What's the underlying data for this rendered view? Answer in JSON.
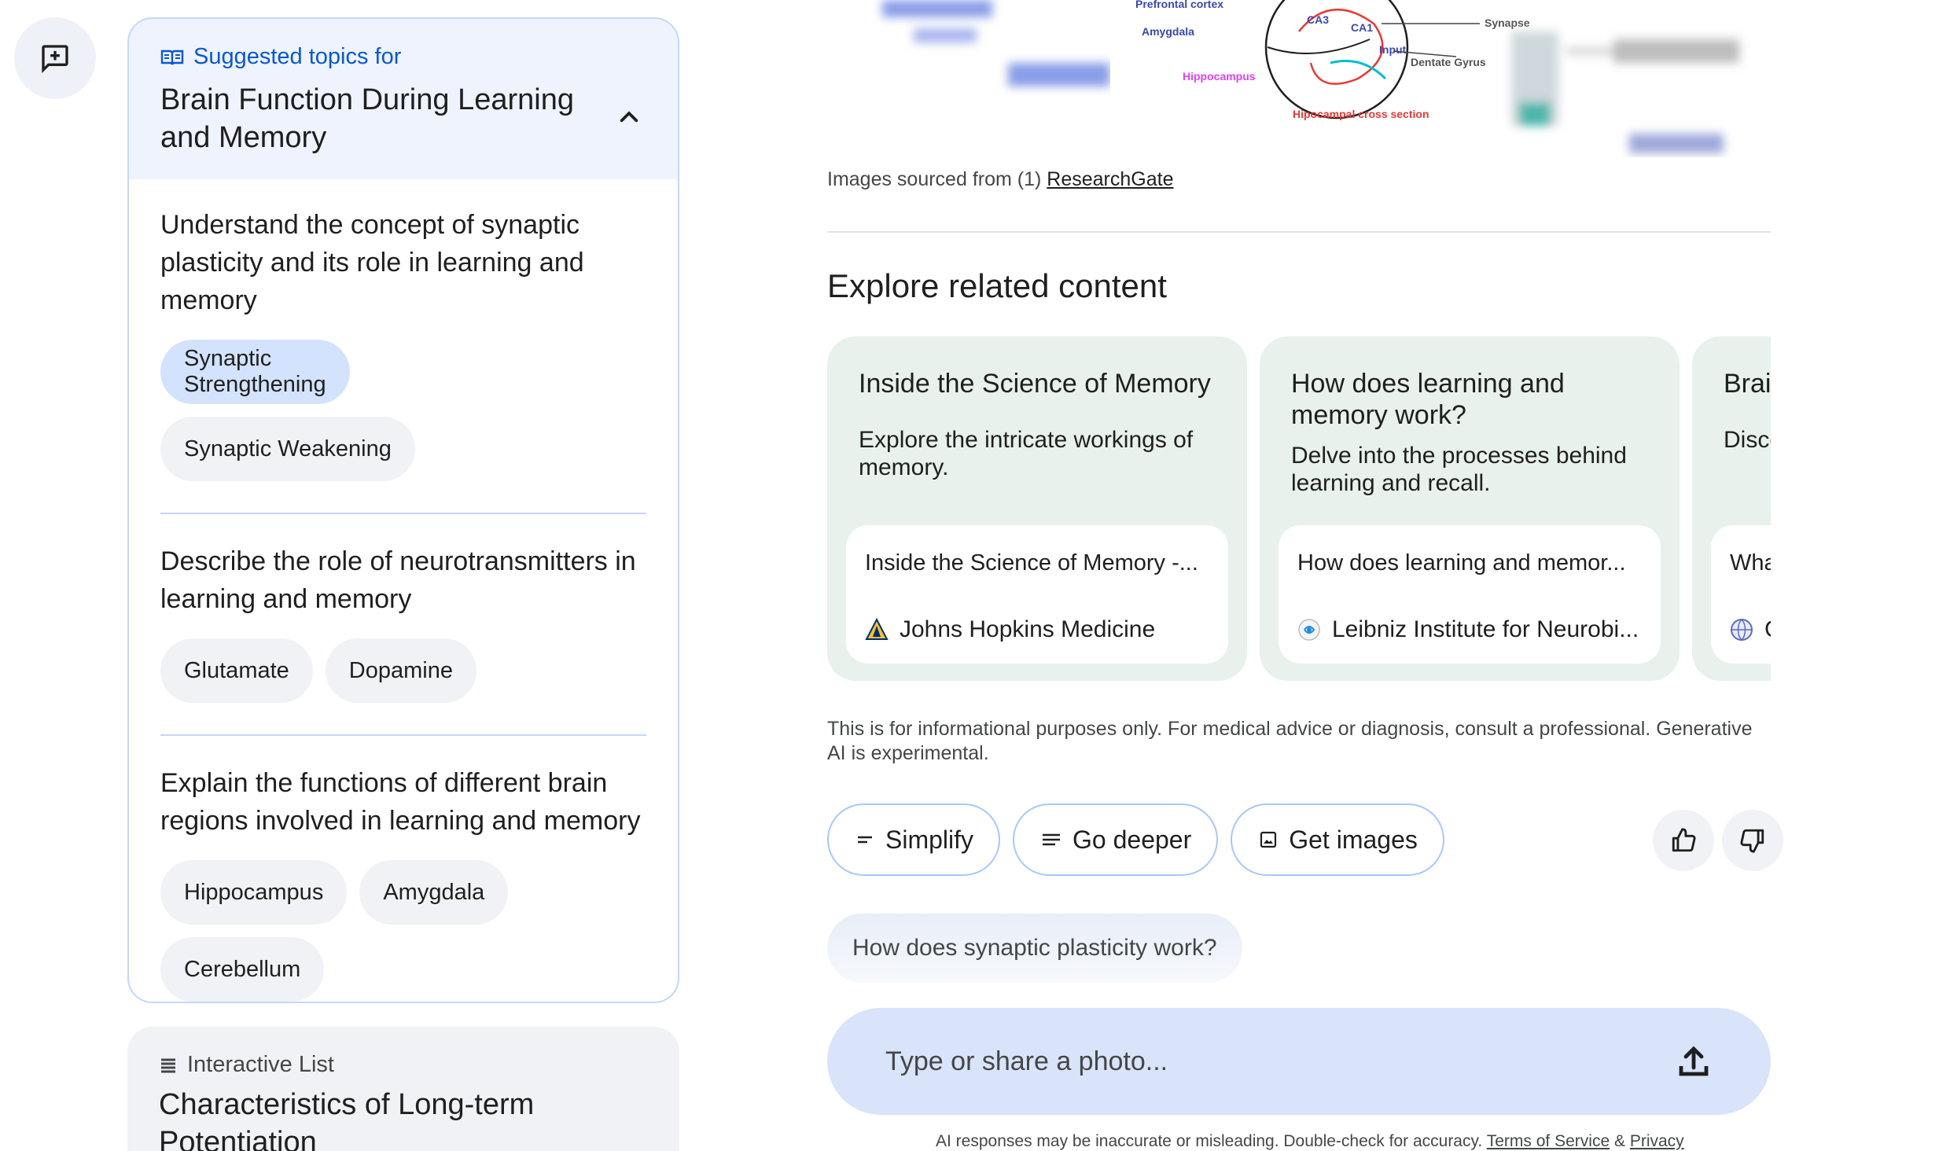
{
  "rail": {
    "new_chat_icon": "new-chat-icon"
  },
  "topics": {
    "kicker": "Suggested topics for",
    "title": "Brain Function During Learning and Memory",
    "sections": [
      {
        "question": "Understand the concept of synaptic plasticity and its role in learning and memory",
        "chips": [
          "Synaptic Strengthening",
          "Synaptic Weakening"
        ]
      },
      {
        "question": "Describe the role of neurotransmitters in learning and memory",
        "chips": [
          "Glutamate",
          "Dopamine"
        ]
      },
      {
        "question": "Explain the functions of different brain regions involved in learning and memory",
        "chips": [
          "Hippocampus",
          "Amygdala",
          "Cerebellum"
        ]
      }
    ]
  },
  "list_card": {
    "kicker": "Interactive List",
    "title": "Characteristics of Long-term Potentiation"
  },
  "image_strip": {
    "labels": [
      "Prefrontal cortex",
      "Amygdala",
      "Hippocampus",
      "CA3",
      "CA1",
      "Synapse",
      "Input",
      "Dentate Gyrus",
      "Hipocampal cross section"
    ],
    "caption_prefix": "Images sourced from (1)",
    "caption_link": "ResearchGate"
  },
  "explore": {
    "title": "Explore related content",
    "cards": [
      {
        "title": "Inside the Science of Memory",
        "desc": "Explore the intricate workings of memory.",
        "source_title": "Inside the Science of Memory -...",
        "source_site": "Johns Hopkins Medicine"
      },
      {
        "title": "How does learning and memory work?",
        "desc": "Delve into the processes behind learning and recall.",
        "source_title": "How does learning and memor...",
        "source_site": "Leibniz Institute for Neurobi..."
      },
      {
        "title": "Brai",
        "desc": "Disco as yo",
        "source_title": "Wha",
        "source_site": "C"
      }
    ]
  },
  "disclaimer": "This is for informational purposes only. For medical advice or diagnosis, consult a professional. Generative AI is experimental.",
  "actions": {
    "simplify": "Simplify",
    "go_deeper": "Go deeper",
    "get_images": "Get images"
  },
  "suggestion": "How does synaptic plasticity work?",
  "composer": {
    "placeholder": "Type or share a photo..."
  },
  "footer": {
    "text": "AI responses may be inaccurate or misleading. Double-check for accuracy.",
    "terms": "Terms of Service",
    "amp": "&",
    "privacy": "Privacy"
  },
  "colors": {
    "accent": "#0b57d0",
    "chip_selected": "#d3e3fd",
    "card_green": "#e8f1ec",
    "composer": "#d9e3f9"
  }
}
